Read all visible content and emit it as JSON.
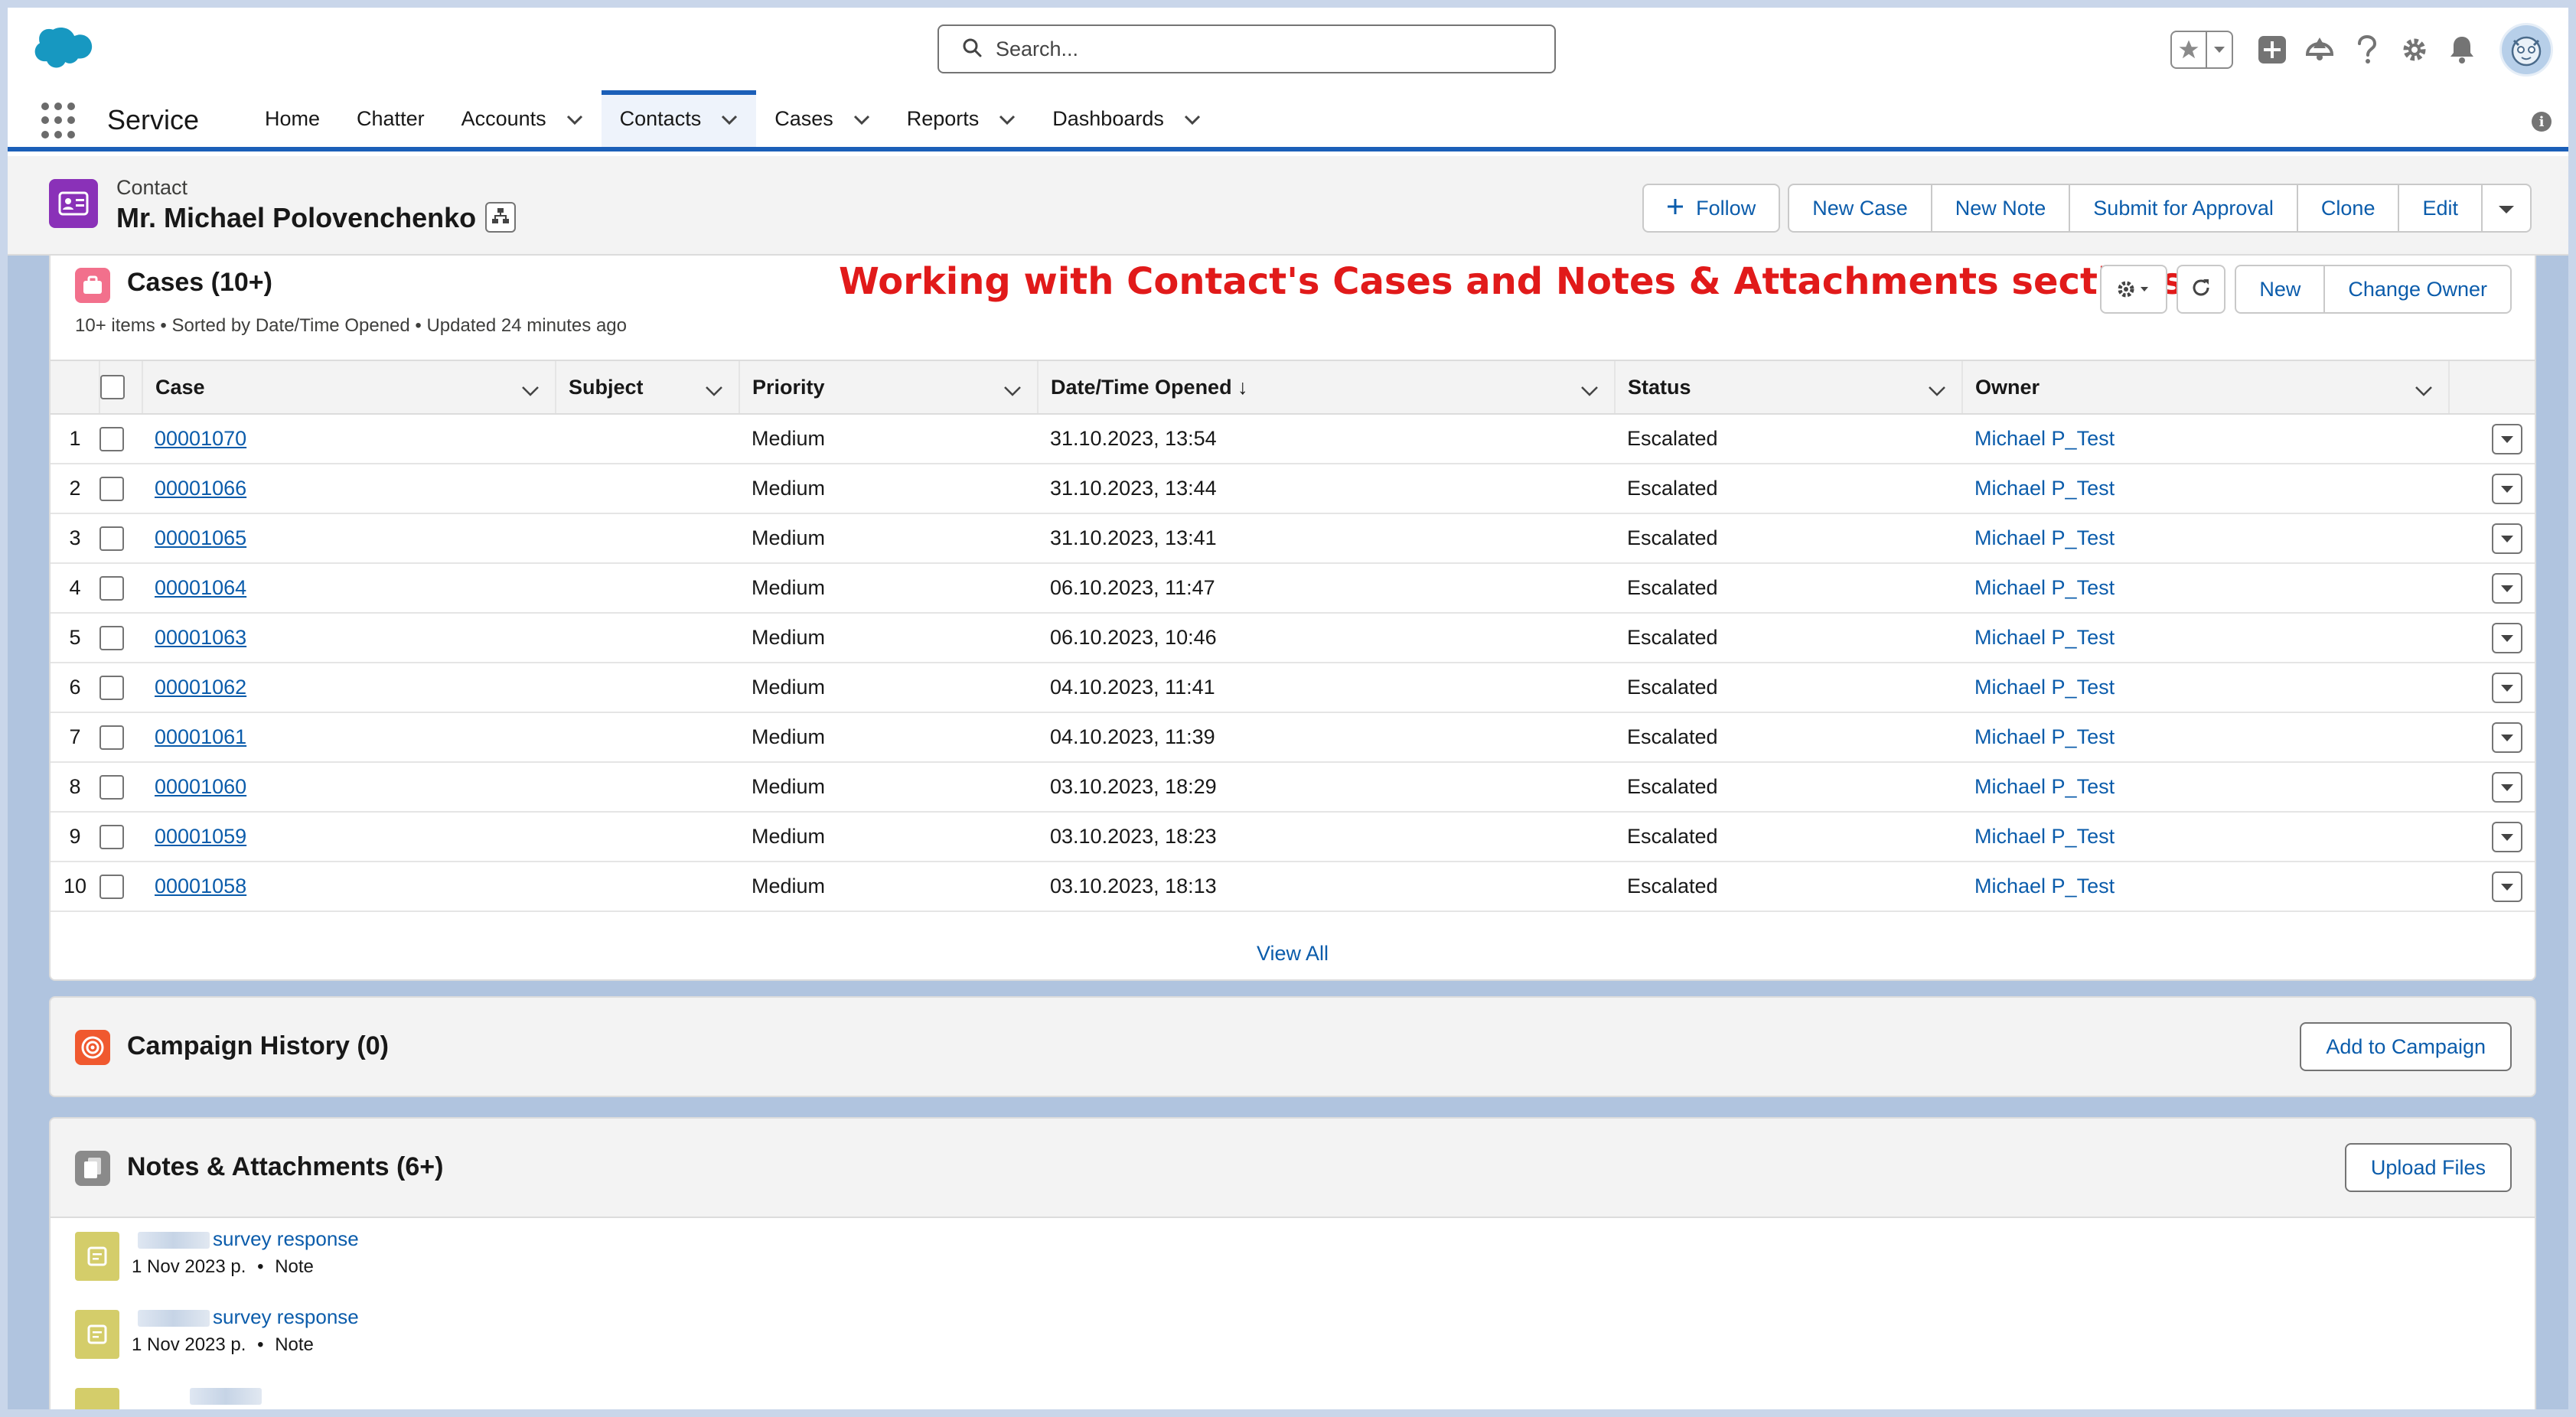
{
  "header": {
    "search_placeholder": "Search...",
    "icons": [
      "favorites-star-icon",
      "favorites-dropdown-icon",
      "global-add-icon",
      "trailhead-icon",
      "help-icon",
      "setup-gear-icon",
      "notifications-bell-icon",
      "avatar"
    ]
  },
  "nav": {
    "app_name": "Service",
    "items": [
      {
        "label": "Home",
        "chevron": false
      },
      {
        "label": "Chatter",
        "chevron": false
      },
      {
        "label": "Accounts",
        "chevron": true
      },
      {
        "label": "Contacts",
        "chevron": true,
        "active": true
      },
      {
        "label": "Cases",
        "chevron": true
      },
      {
        "label": "Reports",
        "chevron": true
      },
      {
        "label": "Dashboards",
        "chevron": true
      }
    ]
  },
  "record": {
    "object_label": "Contact",
    "name": "Mr. Michael Polovenchenko",
    "actions": {
      "follow": "Follow",
      "group": [
        "New Case",
        "New Note",
        "Submit for Approval",
        "Clone",
        "Edit"
      ]
    }
  },
  "annotation": "Working with Contact's Cases and Notes  & Attachments sections",
  "cases": {
    "title": "Cases (10+)",
    "subtitle": "10+ items • Sorted by Date/Time Opened • Updated 24 minutes ago",
    "buttons": {
      "new": "New",
      "change_owner": "Change Owner"
    },
    "columns": [
      "Case",
      "Subject",
      "Priority",
      "Date/Time Opened",
      "Status",
      "Owner"
    ],
    "sort_indicator": "↓",
    "rows": [
      {
        "n": "1",
        "case": "00001070",
        "subject": "",
        "priority": "Medium",
        "opened": "31.10.2023, 13:54",
        "status": "Escalated",
        "owner": "Michael P_Test"
      },
      {
        "n": "2",
        "case": "00001066",
        "subject": "",
        "priority": "Medium",
        "opened": "31.10.2023, 13:44",
        "status": "Escalated",
        "owner": "Michael P_Test"
      },
      {
        "n": "3",
        "case": "00001065",
        "subject": "",
        "priority": "Medium",
        "opened": "31.10.2023, 13:41",
        "status": "Escalated",
        "owner": "Michael P_Test"
      },
      {
        "n": "4",
        "case": "00001064",
        "subject": "",
        "priority": "Medium",
        "opened": "06.10.2023, 11:47",
        "status": "Escalated",
        "owner": "Michael P_Test"
      },
      {
        "n": "5",
        "case": "00001063",
        "subject": "",
        "priority": "Medium",
        "opened": "06.10.2023, 10:46",
        "status": "Escalated",
        "owner": "Michael P_Test"
      },
      {
        "n": "6",
        "case": "00001062",
        "subject": "",
        "priority": "Medium",
        "opened": "04.10.2023, 11:41",
        "status": "Escalated",
        "owner": "Michael P_Test"
      },
      {
        "n": "7",
        "case": "00001061",
        "subject": "",
        "priority": "Medium",
        "opened": "04.10.2023, 11:39",
        "status": "Escalated",
        "owner": "Michael P_Test"
      },
      {
        "n": "8",
        "case": "00001060",
        "subject": "",
        "priority": "Medium",
        "opened": "03.10.2023, 18:29",
        "status": "Escalated",
        "owner": "Michael P_Test"
      },
      {
        "n": "9",
        "case": "00001059",
        "subject": "",
        "priority": "Medium",
        "opened": "03.10.2023, 18:23",
        "status": "Escalated",
        "owner": "Michael P_Test"
      },
      {
        "n": "10",
        "case": "00001058",
        "subject": "",
        "priority": "Medium",
        "opened": "03.10.2023, 18:13",
        "status": "Escalated",
        "owner": "Michael P_Test"
      }
    ],
    "view_all": "View All"
  },
  "campaign": {
    "title": "Campaign History (0)",
    "button": "Add to Campaign"
  },
  "notes": {
    "title": "Notes & Attachments (6+)",
    "button": "Upload Files",
    "items": [
      {
        "title": "survey response",
        "date": "1 Nov 2023 р.",
        "sep": "•",
        "type": "Note"
      },
      {
        "title": "survey response",
        "date": "1 Nov 2023 р.",
        "sep": "•",
        "type": "Note"
      }
    ]
  },
  "colors": {
    "brand_blue": "#0b5cab",
    "nav_active_bar": "#1b5fb8",
    "contact_icon": "#8a31b8",
    "cases_icon": "#f2708c",
    "campaign_icon": "#f0592f",
    "notes_icon": "#8a8a8a",
    "annotation_red": "#e11a1a"
  }
}
